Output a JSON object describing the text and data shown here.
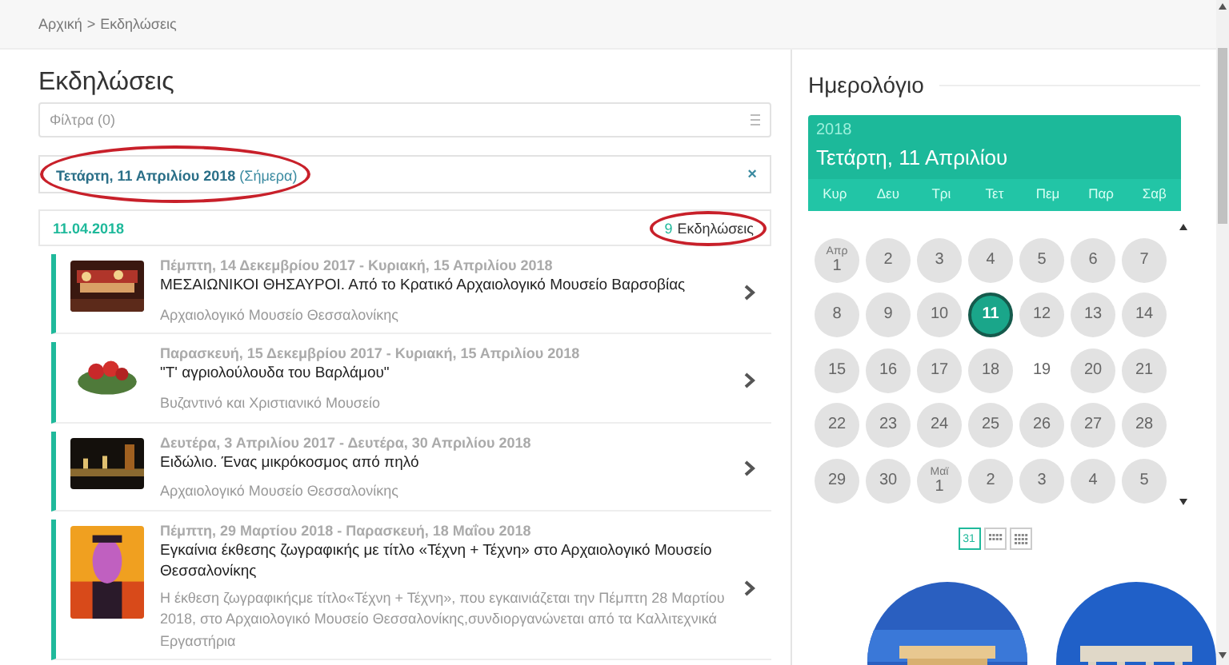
{
  "breadcrumb": {
    "items": [
      "Αρχική",
      "Εκδηλώσεις"
    ],
    "separator": ">"
  },
  "events_panel": {
    "title": "Εκδηλώσεις",
    "filter": {
      "placeholder": "Φίλτρα (0)"
    },
    "selected_date": {
      "text": "**Τετάρτη, 11 Απριλίου 2018** (Σήμερα)",
      "close": "×",
      "circled": true
    },
    "date_group": {
      "date": "11.04.2018",
      "count": "9",
      "count_label": "Εκδηλώσεις",
      "circled": true
    },
    "events": [
      {
        "dates": "Πέμπτη, 14 Δεκεμβρίου 2017 - Κυριακή, 15 Απριλίου 2018",
        "title": "ΜΕΣΑΙΩΝΙΚΟΙ ΘΗΣΑΥΡΟΙ. Από το Κρατικό Αρχαιολογικό Μουσείο Βαρσοβίας",
        "venue": "Αρχαιολογικό Μουσείο Θεσσαλονίκης"
      },
      {
        "dates": "Παρασκευή, 15 Δεκεμβρίου 2017 - Κυριακή, 15 Απριλίου 2018",
        "title": "\"Τ' αγριολούλουδα του Βαρλάμου\"",
        "venue": "Βυζαντινό και Χριστιανικό Μουσείο"
      },
      {
        "dates": "Δευτέρα, 3 Απριλίου 2017 - Δευτέρα, 30 Απριλίου 2018",
        "title": "Ειδώλιο. Ένας μικρόκοσμος από πηλό",
        "venue": "Αρχαιολογικό Μουσείο Θεσσαλονίκης"
      },
      {
        "dates": "Πέμπτη, 29 Μαρτίου 2018 - Παρασκευή, 18 Μαΐου 2018",
        "title": "Εγκαίνια έκθεσης ζωγραφικής με τίτλο «Τέχνη + Τέχνη» στο Αρχαιολογικό Μουσείο Θεσσαλονίκης",
        "description": "Η έκθεση ζωγραφικήςμε τίτλο«Τέχνη + Τέχνη», που εγκαινιάζεται την Πέμπτη 28 Μαρτίου 2018, στο Αρχαιολογικό Μουσείο Θεσσαλονίκης,συνδιοργανώνεται από τα Καλλιτεχνικά Εργαστήρια"
      }
    ]
  },
  "calendar_panel": {
    "title": "Ημερολόγιο",
    "calendar": {
      "year": "2018",
      "date": "Τετάρτη, 11 Απριλίου",
      "weekdays": [
        "Κυρ",
        "Δευ",
        "Τρι",
        "Τετ",
        "Πεμ",
        "Παρ",
        "Σαβ"
      ],
      "days": [
        {
          "label": "1",
          "month": "Απρ",
          "highlighted": true,
          "selected": false
        },
        {
          "label": "2",
          "highlighted": true,
          "selected": false
        },
        {
          "label": "3",
          "highlighted": true,
          "selected": false
        },
        {
          "label": "4",
          "highlighted": true,
          "selected": false
        },
        {
          "label": "5",
          "highlighted": true,
          "selected": false
        },
        {
          "label": "6",
          "highlighted": true,
          "selected": false
        },
        {
          "label": "7",
          "highlighted": true,
          "selected": false
        },
        {
          "label": "8",
          "highlighted": true,
          "selected": false
        },
        {
          "label": "9",
          "highlighted": true,
          "selected": false
        },
        {
          "label": "10",
          "highlighted": true,
          "selected": false
        },
        {
          "label": "11",
          "highlighted": true,
          "selected": true
        },
        {
          "label": "12",
          "highlighted": true,
          "selected": false
        },
        {
          "label": "13",
          "highlighted": true,
          "selected": false
        },
        {
          "label": "14",
          "highlighted": true,
          "selected": false
        },
        {
          "label": "15",
          "highlighted": true,
          "selected": false
        },
        {
          "label": "16",
          "highlighted": true,
          "selected": false
        },
        {
          "label": "17",
          "highlighted": true,
          "selected": false
        },
        {
          "label": "18",
          "highlighted": true,
          "selected": false
        },
        {
          "label": "19",
          "highlighted": false,
          "selected": false
        },
        {
          "label": "20",
          "highlighted": true,
          "selected": false
        },
        {
          "label": "21",
          "highlighted": true,
          "selected": false
        },
        {
          "label": "22",
          "highlighted": true,
          "selected": false
        },
        {
          "label": "23",
          "highlighted": true,
          "selected": false
        },
        {
          "label": "24",
          "highlighted": true,
          "selected": false
        },
        {
          "label": "25",
          "highlighted": true,
          "selected": false
        },
        {
          "label": "26",
          "highlighted": true,
          "selected": false
        },
        {
          "label": "27",
          "highlighted": true,
          "selected": false
        },
        {
          "label": "28",
          "highlighted": true,
          "selected": false
        },
        {
          "label": "29",
          "highlighted": true,
          "selected": false
        },
        {
          "label": "30",
          "highlighted": true,
          "selected": false
        },
        {
          "label": "1",
          "month": "Μαϊ",
          "highlighted": true,
          "selected": false
        },
        {
          "label": "2",
          "highlighted": true,
          "selected": false
        },
        {
          "label": "3",
          "highlighted": true,
          "selected": false
        },
        {
          "label": "4",
          "highlighted": true,
          "selected": false
        },
        {
          "label": "5",
          "highlighted": true,
          "selected": false
        }
      ],
      "views": [
        {
          "kind": "day",
          "label": "31",
          "selected": true
        },
        {
          "kind": "week",
          "selected": false
        },
        {
          "kind": "month",
          "selected": false
        }
      ]
    }
  }
}
